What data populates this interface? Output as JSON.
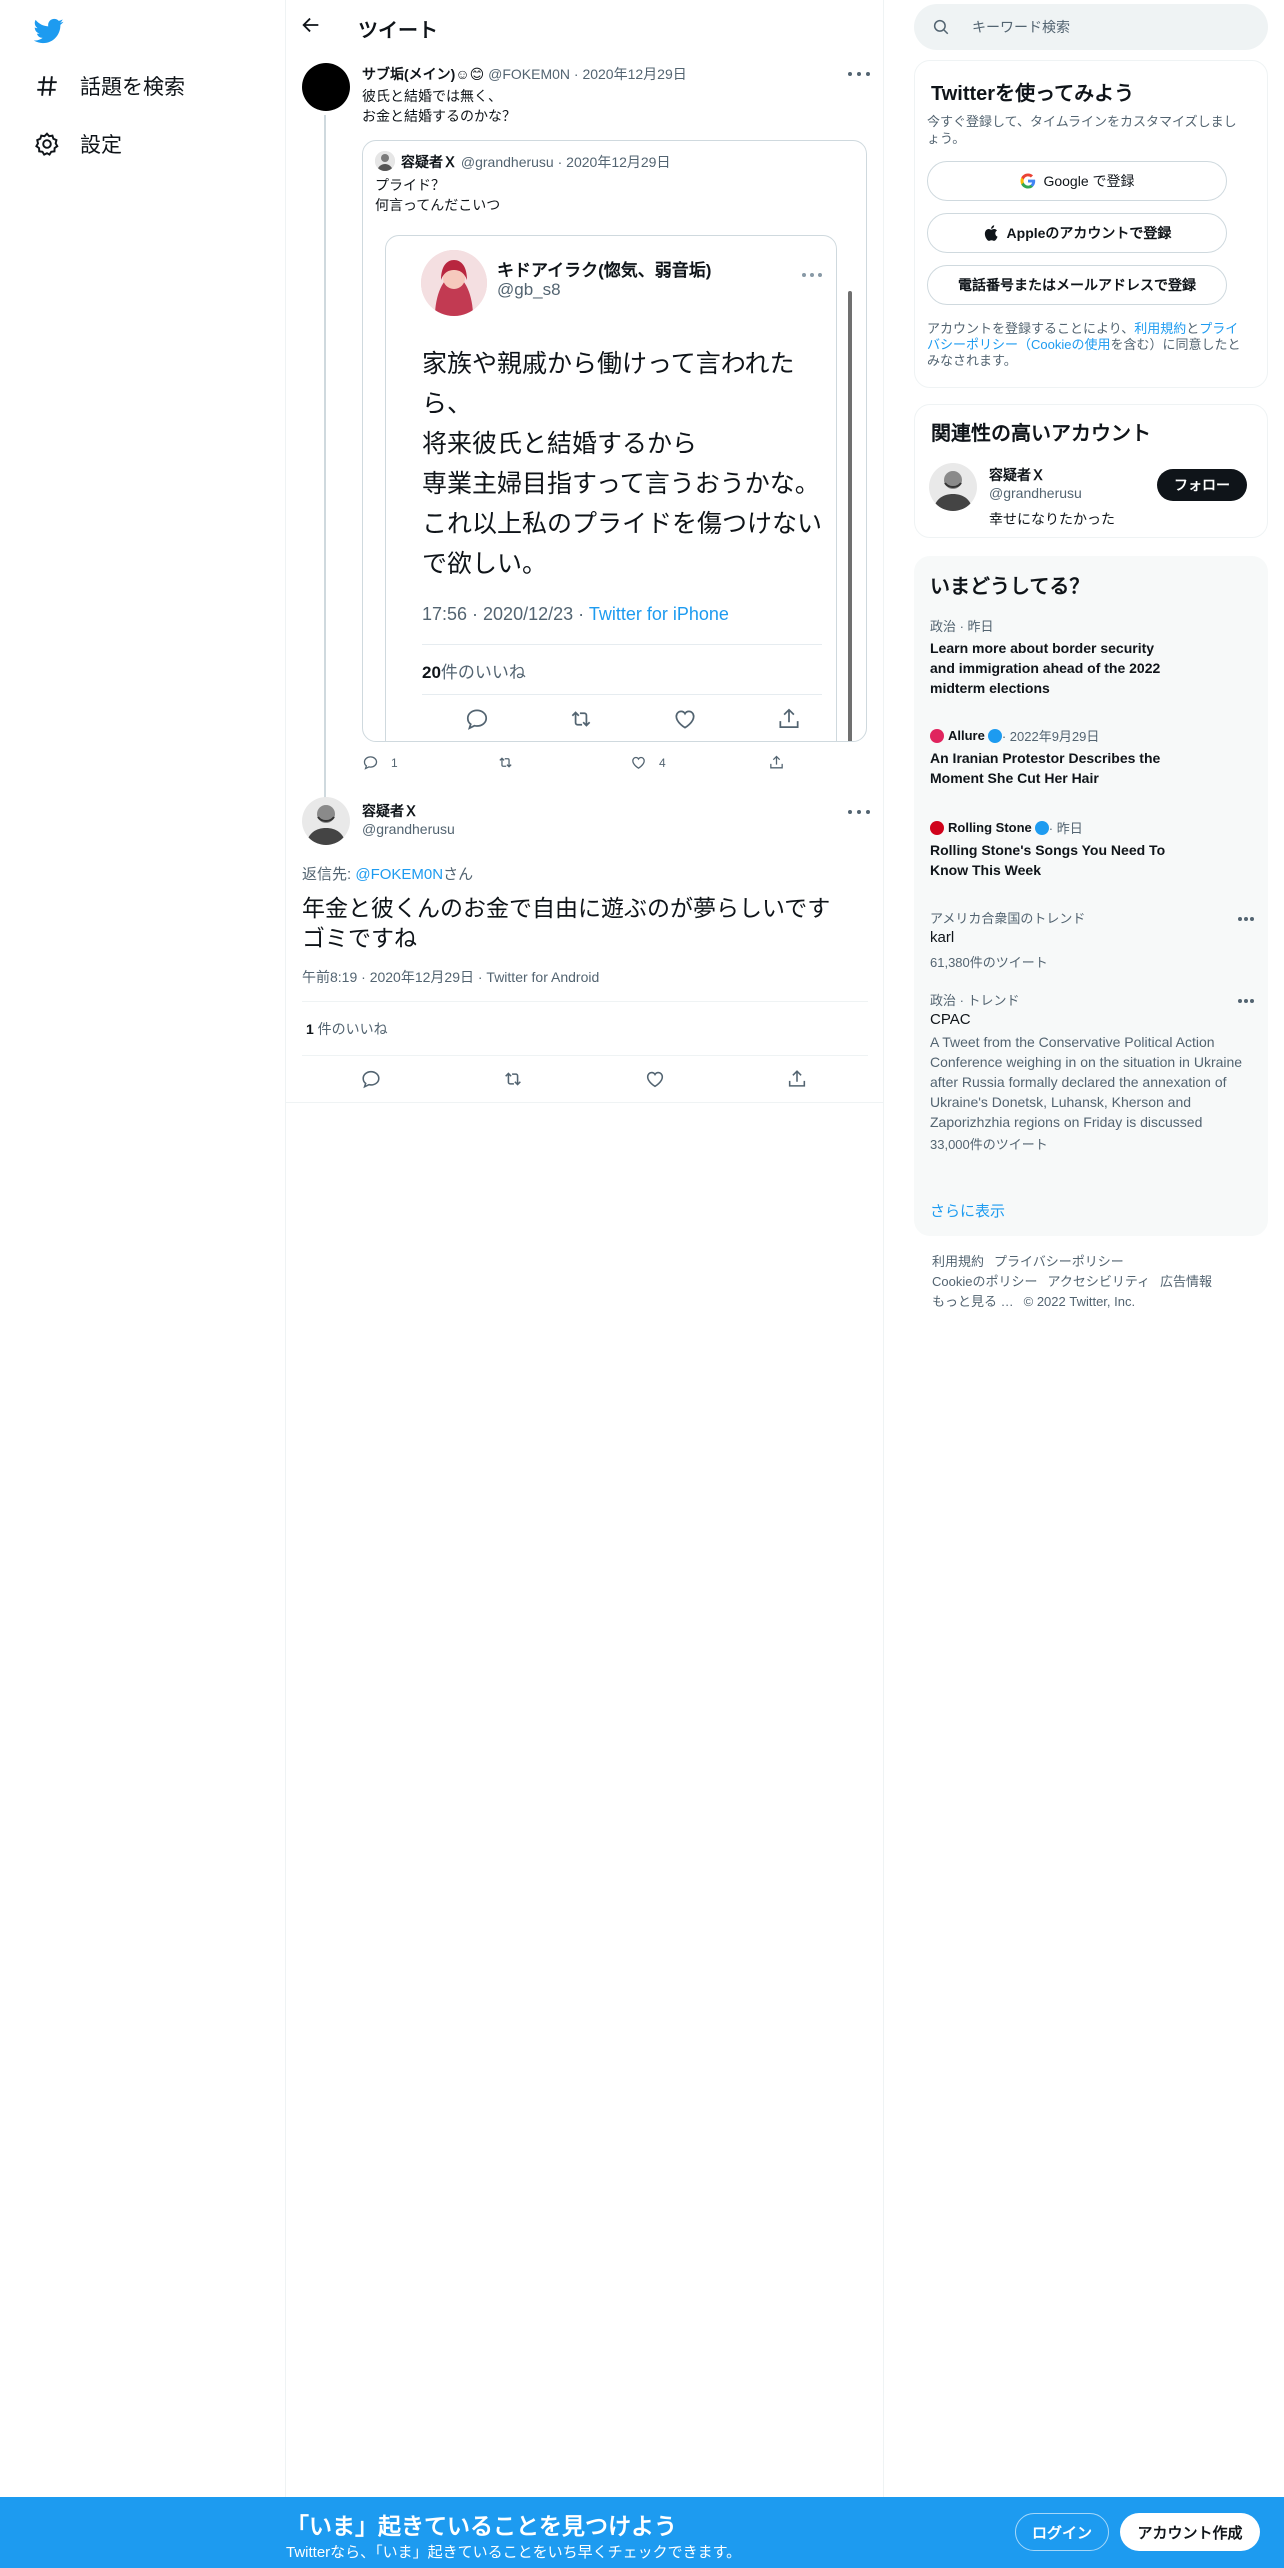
{
  "nav": {
    "logo": "twitter-bird-icon",
    "explore_label": "話題を検索",
    "settings_label": "設定"
  },
  "header": {
    "title": "ツイート"
  },
  "tweet1": {
    "name": "サブ垢(メイン)☺😊",
    "handle": "@FOKEM0N",
    "date": "2020年12月29日",
    "text_line1": "彼氏と結婚では無く、",
    "text_line2": "お金と結婚するのかな？",
    "quote": {
      "name": "容疑者Ｘ",
      "handle": "@grandherusu",
      "date": "2020年12月29日",
      "text_line1": "プライド？",
      "text_line2": "何言ってんだこいつ",
      "embed": {
        "name": "キドアイラク(惚気、弱音垢)",
        "handle": "@gb_s8",
        "body_lines": [
          "家族や親戚から働けって言われた",
          "ら、",
          "将来彼氏と結婚するから",
          "専業主婦目指すって言うおうかな。",
          "これ以上私のプライドを傷つけない",
          "で欲しい。"
        ],
        "time": "17:56 · 2020/12/23 · ",
        "via": "Twitter for iPhone",
        "likes_num": "20",
        "likes_label": "件のいいね"
      }
    },
    "reply_count": "1",
    "like_count": "4"
  },
  "tweet2": {
    "name": "容疑者Ｘ",
    "handle": "@grandherusu",
    "reply_prefix": "返信先: ",
    "reply_to": "@FOKEM0N",
    "reply_suffix": "さん",
    "text_line1": "年金と彼くんのお金で自由に遊ぶのが夢らしいです",
    "text_line2": "ゴミですね",
    "meta": "午前8:19 · 2020年12月29日 · Twitter for Android",
    "likes_num": "1",
    "likes_label": " 件のいいね"
  },
  "search": {
    "placeholder": "キーワード検索"
  },
  "signup_card": {
    "title": "Twitterを使ってみよう",
    "subtitle": "今すぐ登録して、タイムラインをカスタマイズしましょう。",
    "google_label": "Google で登録",
    "apple_label": "Appleのアカウントで登録",
    "email_label": "電話番号またはメールアドレスで登録",
    "legal_prefix": "アカウントを登録することにより、",
    "legal_terms": "利用規約",
    "legal_and": "と",
    "legal_privacy": "プライバシーポリシー（Cookieの使用",
    "legal_suffix": "を含む）に同意したとみなされます。"
  },
  "relevant_card": {
    "title": "関連性の高いアカウント",
    "name": "容疑者Ｘ",
    "handle": "@grandherusu",
    "bio": "幸せになりたかった",
    "follow_label": "フォロー"
  },
  "trends_card": {
    "title": "いまどうしてる？",
    "items": [
      {
        "meta": "政治 · 昨日",
        "title_lines": [
          "Learn more about border security",
          "and immigration ahead of the 2022",
          "midterm elections"
        ]
      },
      {
        "source": "Allure",
        "meta": " · 2022年9月29日",
        "title_lines": [
          "An Iranian Protestor Describes the",
          "Moment She Cut Her Hair"
        ]
      },
      {
        "source": "Rolling Stone",
        "meta": " · 昨日",
        "title_lines": [
          "Rolling Stone's Songs You Need To",
          "Know This Week"
        ]
      },
      {
        "meta": "アメリカ合衆国のトレンド",
        "name": "karl",
        "count": "61,380件のツイート"
      },
      {
        "meta": "政治 · トレンド",
        "name": "CPAC",
        "desc": "A Tweet from the Conservative Political Action Conference weighing in on the situation in Ukraine after Russia formally declared the annexation of Ukraine's Donetsk, Luhansk, Kherson and Zaporizhzhia regions on Friday is discussed",
        "count": "33,000件のツイート"
      }
    ],
    "show_more": "さらに表示"
  },
  "footer": {
    "terms": "利用規約",
    "privacy": "プライバシーポリシー",
    "cookies": "Cookieのポリシー",
    "accessibility": "アクセシビリティ",
    "ads": "広告情報",
    "more": "もっと見る …",
    "copyright": "© 2022 Twitter, Inc."
  },
  "bottom_bar": {
    "title": "「いま」起きていることを見つけよう",
    "subtitle": "Twitterなら、「いま」起きていることをいち早くチェックできます。",
    "login_label": "ログイン",
    "signup_label": "アカウント作成"
  },
  "colors": {
    "accent": "#1d9bf0",
    "text": "#0f1419",
    "muted": "#536471",
    "border": "#eff3f4"
  }
}
